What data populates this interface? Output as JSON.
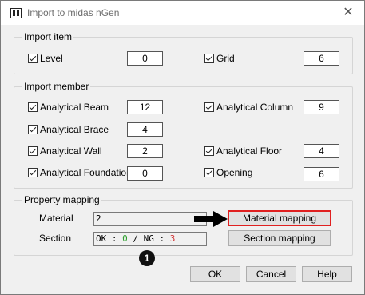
{
  "window": {
    "title": "Import to midas nGen",
    "close_glyph": "✕"
  },
  "import_item": {
    "label": "Import item",
    "level": {
      "label": "Level",
      "checked": true,
      "count": "0"
    },
    "grid": {
      "label": "Grid",
      "checked": true,
      "count": "6"
    }
  },
  "import_member": {
    "label": "Import member",
    "analytical_beam": {
      "label": "Analytical Beam",
      "checked": true,
      "count": "12"
    },
    "analytical_column": {
      "label": "Analytical Column",
      "checked": true,
      "count": "9"
    },
    "analytical_brace": {
      "label": "Analytical Brace",
      "checked": true,
      "count": "4"
    },
    "analytical_wall": {
      "label": "Analytical Wall",
      "checked": true,
      "count": "2"
    },
    "analytical_floor": {
      "label": "Analytical Floor",
      "checked": true,
      "count": "4"
    },
    "analytical_foundation": {
      "label": "Analytical Foundation",
      "checked": true,
      "count": "0"
    },
    "opening": {
      "label": "Opening",
      "checked": true,
      "count": "6"
    }
  },
  "property_mapping": {
    "label": "Property mapping",
    "material_label": "Material",
    "material_value": "2",
    "section_label": "Section",
    "section_ok_prefix": "OK : ",
    "section_ok_value": "0",
    "section_sep": " / NG : ",
    "section_ng_value": "3",
    "material_mapping_button": "Material mapping",
    "section_mapping_button": "Section mapping"
  },
  "callout_badge": "1",
  "buttons": {
    "ok": "OK",
    "cancel": "Cancel",
    "help": "Help"
  },
  "colors": {
    "highlight": "#e02020",
    "ok_value": "#2a9d2a",
    "ng_value": "#d03030"
  }
}
